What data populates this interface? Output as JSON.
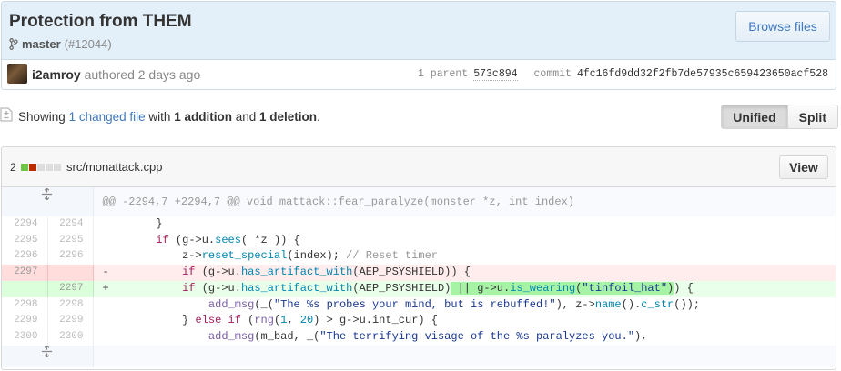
{
  "commit": {
    "title": "Protection from THEM",
    "branch": "master",
    "pr_ref": "(#12044)",
    "browse_label": "Browse files",
    "author": "i2amroy",
    "authored_text": "authored 2 days ago",
    "parent_label": "1 parent",
    "parent_sha": "573c894",
    "commit_label": "commit",
    "commit_sha": "4fc16fd9dd32f2fb7de57935c659423650acf528"
  },
  "toc": {
    "showing": "Showing",
    "changed_files": "1 changed file",
    "with": "with",
    "additions": "1 addition",
    "and": "and",
    "deletions": "1 deletion",
    "period": ".",
    "unified_label": "Unified",
    "split_label": "Split",
    "active_view": "Unified"
  },
  "file": {
    "change_count": "2",
    "path": "src/monattack.cpp",
    "view_label": "View",
    "hunk_header": "@@ -2294,7 +2294,7 @@ void mattack::fear_paralyze(monster *z, int index)",
    "lines": [
      {
        "old": "2294",
        "new": "2294"
      },
      {
        "old": "2295",
        "new": "2295"
      },
      {
        "old": "2296",
        "new": "2296"
      },
      {
        "old": "2297",
        "new": "",
        "marker": "-"
      },
      {
        "old": "",
        "new": "2297",
        "marker": "+"
      },
      {
        "old": "2298",
        "new": "2298"
      },
      {
        "old": "2299",
        "new": "2299"
      },
      {
        "old": "2300",
        "new": "2300"
      }
    ]
  },
  "colors": {
    "accent": "#4078c0",
    "addition": "#6cc644",
    "deletion": "#bd2c00"
  }
}
